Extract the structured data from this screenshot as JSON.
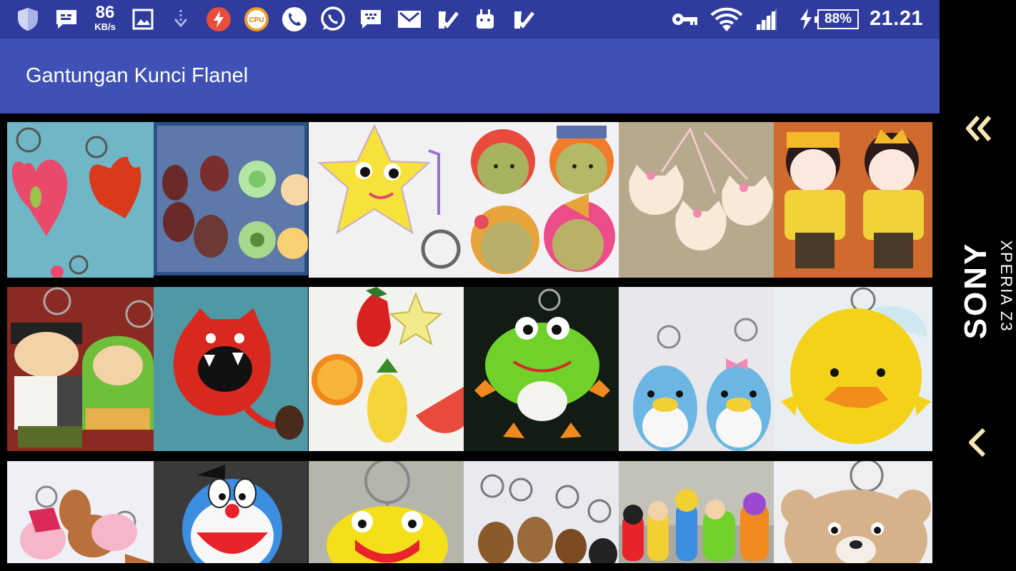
{
  "status_bar": {
    "network_speed_value": "86",
    "network_speed_unit": "KB/s",
    "cpu_label": "CPU",
    "battery_percent": "88%",
    "time": "21.21",
    "icons": [
      "shield-icon",
      "message-icon",
      "image-icon",
      "download-icon",
      "flash-icon",
      "cpu-icon",
      "phone-icon",
      "whatsapp-icon",
      "bbm-icon",
      "gmail-icon",
      "check-icon",
      "android-icon",
      "check-icon",
      "key-icon",
      "wifi-icon",
      "signal-icon",
      "battery-charging-icon"
    ]
  },
  "app_bar": {
    "title": "Gantungan Kunci Flanel",
    "color": "#3f51b5"
  },
  "gallery": {
    "items": [
      {
        "subject": "felt hearts keychain"
      },
      {
        "subject": "felt fruits keychain"
      },
      {
        "subject": "felt star keychain"
      },
      {
        "subject": "felt girls faces keychain"
      },
      {
        "subject": "felt cats keychain"
      },
      {
        "subject": "felt couple dolls keychain"
      },
      {
        "subject": "felt couple muslim dolls keychain"
      },
      {
        "subject": "felt red monster keychain"
      },
      {
        "subject": "felt fruits set"
      },
      {
        "subject": "felt frog keychain"
      },
      {
        "subject": "felt penguins keychain"
      },
      {
        "subject": "felt chick keychain"
      },
      {
        "subject": "felt camels keychain"
      },
      {
        "subject": "felt doraemon keychain"
      },
      {
        "subject": "felt yellow frog keychain"
      },
      {
        "subject": "wooden keychains"
      },
      {
        "subject": "felt finger puppets"
      },
      {
        "subject": "felt bear keychain"
      }
    ]
  },
  "nav_bar": {
    "brand": "SONY",
    "model": "XPERIA Z3",
    "icon_color": "#f7e6b5"
  }
}
